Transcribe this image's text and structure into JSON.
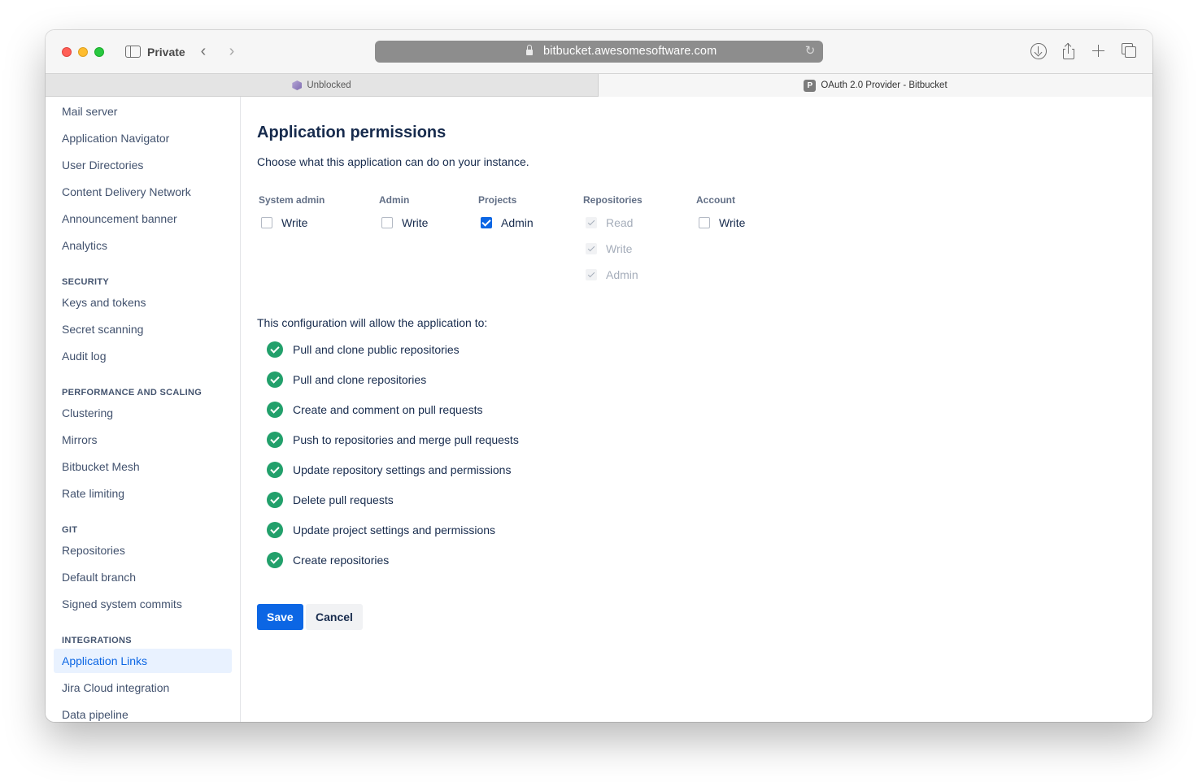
{
  "browser": {
    "private_label": "Private",
    "url": "bitbucket.awesomesoftware.com",
    "tabs": [
      {
        "title": "Unblocked",
        "active": false
      },
      {
        "title": "OAuth 2.0 Provider - Bitbucket",
        "active": true,
        "favicon_letter": "P"
      }
    ]
  },
  "sidebar": {
    "items_top": [
      "Mail server",
      "Application Navigator",
      "User Directories",
      "Content Delivery Network",
      "Announcement banner",
      "Analytics"
    ],
    "sections": [
      {
        "heading": "SECURITY",
        "items": [
          "Keys and tokens",
          "Secret scanning",
          "Audit log"
        ]
      },
      {
        "heading": "PERFORMANCE AND SCALING",
        "items": [
          "Clustering",
          "Mirrors",
          "Bitbucket Mesh",
          "Rate limiting"
        ]
      },
      {
        "heading": "GIT",
        "items": [
          "Repositories",
          "Default branch",
          "Signed system commits"
        ]
      },
      {
        "heading": "INTEGRATIONS",
        "items": [
          "Application Links",
          "Jira Cloud integration",
          "Data pipeline"
        ]
      }
    ],
    "selected": "Application Links"
  },
  "main": {
    "title": "Application permissions",
    "description": "Choose what this application can do on your instance.",
    "permission_groups": [
      {
        "heading": "System admin",
        "options": [
          {
            "label": "Write",
            "checked": false,
            "disabled": false
          }
        ]
      },
      {
        "heading": "Admin",
        "options": [
          {
            "label": "Write",
            "checked": false,
            "disabled": false
          }
        ]
      },
      {
        "heading": "Projects",
        "options": [
          {
            "label": "Admin",
            "checked": true,
            "disabled": false
          }
        ]
      },
      {
        "heading": "Repositories",
        "options": [
          {
            "label": "Read",
            "checked": true,
            "disabled": true
          },
          {
            "label": "Write",
            "checked": true,
            "disabled": true
          },
          {
            "label": "Admin",
            "checked": true,
            "disabled": true
          }
        ]
      },
      {
        "heading": "Account",
        "options": [
          {
            "label": "Write",
            "checked": false,
            "disabled": false
          }
        ]
      }
    ],
    "allow_title": "This configuration will allow the application to:",
    "allowed": [
      "Pull and clone public repositories",
      "Pull and clone repositories",
      "Create and comment on pull requests",
      "Push to repositories and merge pull requests",
      "Update repository settings and permissions",
      "Delete pull requests",
      "Update project settings and permissions",
      "Create repositories"
    ],
    "save_label": "Save",
    "cancel_label": "Cancel"
  },
  "colors": {
    "primary": "#0c66e4",
    "success": "#22a06b",
    "selected_nav_bg": "#e9f2ff"
  }
}
